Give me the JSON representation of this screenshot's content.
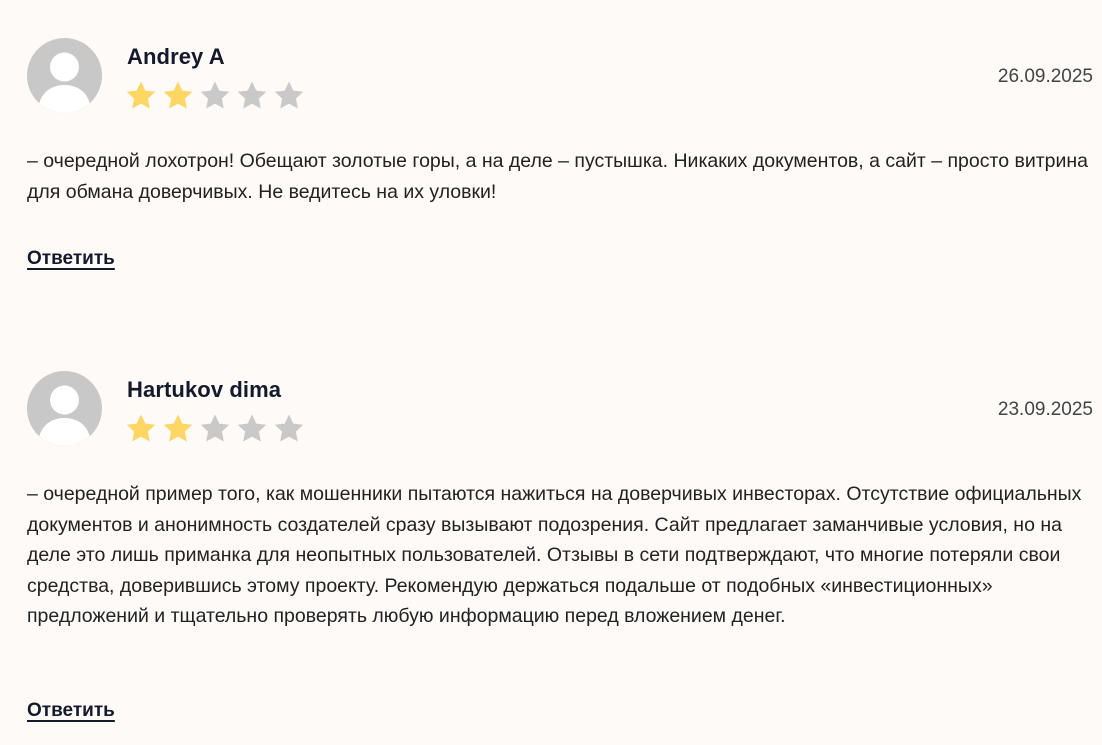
{
  "reviews": [
    {
      "author": "Andrey A",
      "date": "26.09.2025",
      "rating": 2,
      "rating_max": 5,
      "text": "– очередной лохотрон! Обещают золотые горы, а на деле – пустышка. Никаких документов, а сайт – просто витрина для обмана доверчивых. Не ведитесь на их уловки!",
      "reply_label": "Ответить"
    },
    {
      "author": "Hartukov dima",
      "date": "23.09.2025",
      "rating": 2,
      "rating_max": 5,
      "text": "– очередной пример того, как мошенники пытаются нажиться на доверчивых инвесторах. Отсутствие официальных документов и анонимность создателей сразу вызывают подозрения. Сайт предлагает заманчивые условия, но на деле это лишь приманка для неопытных пользователей. Отзывы в сети подтверждают, что многие потеряли свои средства, доверившись этому проекту. Рекомендую держаться подальше от подобных «инвестиционных» предложений и тщательно проверять любую информацию перед вложением денег.",
      "reply_label": "Ответить"
    }
  ],
  "colors": {
    "star_filled": "#fdd663",
    "star_empty": "#c9c9c9",
    "avatar_bg": "#c8c8c8",
    "avatar_fg": "#ffffff"
  },
  "icons": {
    "avatar": "user-silhouette-icon",
    "star": "star-icon"
  }
}
